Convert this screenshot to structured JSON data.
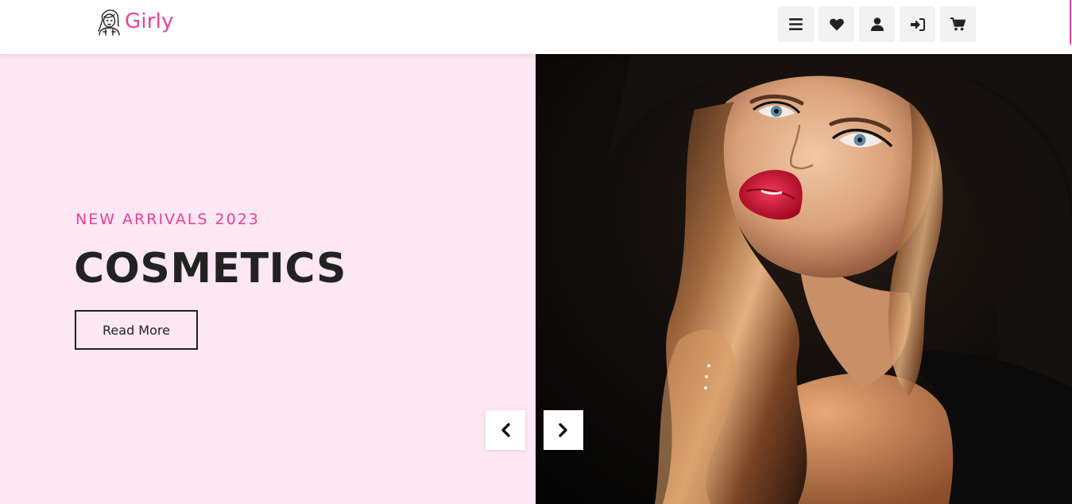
{
  "brand": {
    "name": "Girly",
    "accent_color": "#e84393",
    "logo_icon": "girl-face-icon"
  },
  "header": {
    "actions": [
      {
        "icon": "bars-icon",
        "name": "menu"
      },
      {
        "icon": "heart-icon",
        "name": "wishlist"
      },
      {
        "icon": "user-icon",
        "name": "account"
      },
      {
        "icon": "sign-in-icon",
        "name": "login"
      },
      {
        "icon": "cart-icon",
        "name": "cart"
      }
    ]
  },
  "hero": {
    "kicker": "NEW ARRIVALS 2023",
    "title": "COSMETICS",
    "cta_label": "Read More",
    "background_color": "#fce7f2",
    "image_subject": "model-with-red-lips-photo",
    "prev_icon": "chevron-left-icon",
    "next_icon": "chevron-right-icon"
  }
}
